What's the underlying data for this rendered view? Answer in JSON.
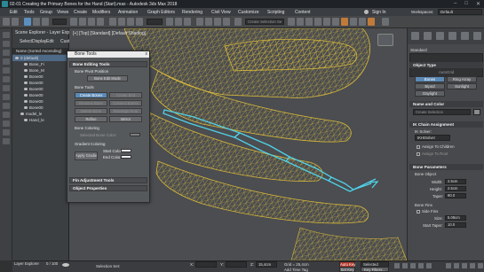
{
  "window": {
    "title": "02-01 Creating the Primary Bones for the Hand (Start).max - Autodesk 3ds Max 2018"
  },
  "menu": {
    "items": [
      "Edit",
      "Tools",
      "Group",
      "Views",
      "Create",
      "Modifiers",
      "Animation",
      "Graph Editors",
      "Rendering",
      "Civil View",
      "Customize",
      "Scripting",
      "Content"
    ],
    "sign_in": "Sign In",
    "workspaces_label": "Workspaces:",
    "workspaces_value": "Default"
  },
  "toolbar": {
    "selection_set_placeholder": "Create Selection Se"
  },
  "scene_explorer": {
    "title": "Scene Explorer - Layer Explorer",
    "menu": [
      "Select",
      "Display",
      "Edit",
      "Customize"
    ],
    "column_header": "Name (Sorted Ascending)",
    "rows": [
      "0 (default)",
      "Bone_Fi",
      "Bone_M",
      "Bone00",
      "Bone00",
      "Bone00",
      "Bone00",
      "Bone00",
      "Bone00",
      "model_le",
      "Hand_le"
    ],
    "layer_explorer_label": "Layer Explorer"
  },
  "viewport": {
    "label": "[+] [Top] [Standard] [Default Shading]"
  },
  "bone_tools": {
    "title": "Bone Tools",
    "close": "x",
    "editing_tools_header": "Bone Editing Tools",
    "pivot_label": "Bone Pivot Position",
    "bone_edit_mode": "Bone Edit Mode",
    "bone_tools_label": "Bone Tools",
    "create_bones": "Create Bones",
    "create_end": "Create End",
    "remove_bone": "Remove Bone",
    "connect_bones": "Connect Bones",
    "delete_bone": "Delete Bone",
    "reassign_root": "Reassign Root",
    "refine": "Refine",
    "mirror": "Mirror",
    "coloring_label": "Bone Coloring",
    "selected_bone_color": "Selected Bone Color:",
    "gradient_coloring": "Gradient Coloring",
    "apply_gradient": "Apply Gradient",
    "start_color": "Start Color:",
    "end_color": "End Color:",
    "fin_header": "Fin Adjustment Tools",
    "object_properties_header": "Object Properties"
  },
  "command_panel": {
    "standard": "Standard",
    "object_type_header": "Object Type",
    "autogrid": "AutoGrid",
    "buttons": [
      "Bones",
      "Ring Array",
      "Biped",
      "Sunlight",
      "Daylight"
    ],
    "name_color_header": "Name and Color",
    "name_value": "Create Selection",
    "ik_header": "IK Chain Assignment",
    "ik_solver_label": "IK Solver:",
    "ik_solver_value": "IKHISolver",
    "assign_children": "Assign To Children",
    "assign_root": "Assign To Root",
    "bone_params_header": "Bone Parameters",
    "bone_object": "Bone Object",
    "width_label": "Width:",
    "width_value": "2.5cm",
    "height_label": "Height:",
    "height_value": "2.5cm",
    "taper_label": "Taper:",
    "taper_value": "90.0",
    "bone_fins": "Bone Fins",
    "side_fins": "Side Fins",
    "size_label": "Size:",
    "size_value": "5.08cm",
    "start_taper_label": "Start Taper:",
    "start_taper_value": "10.0"
  },
  "status": {
    "frame": "0 / 100",
    "selection_set": "Selection Set:",
    "x_label": "X:",
    "y_label": "Y:",
    "z_label": "Z:",
    "z_value": "15,4cm",
    "grid": "Grid = 25,4cm",
    "add_time_tag": "Add Time Tag",
    "auto_key": "Auto Key",
    "set_key": "Set Key",
    "selected": "Selected",
    "key_filters": "Key Filters..."
  },
  "colors": {
    "accent_blue": "#5b89b6",
    "wire_yellow": "#d8b83a",
    "bone_cyan": "#4fd2e8",
    "auto_key_red": "#b0362a"
  }
}
